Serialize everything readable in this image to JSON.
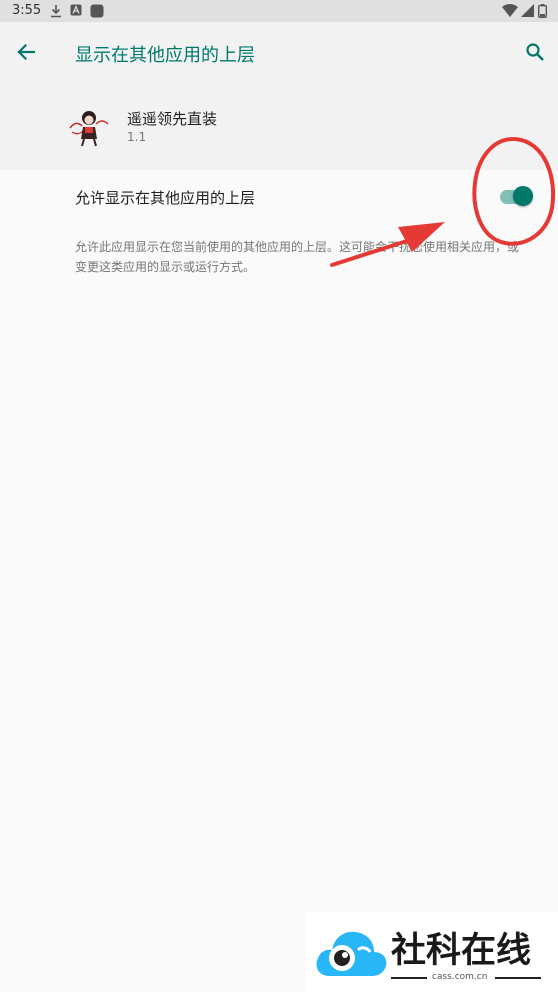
{
  "status_bar": {
    "time": "3:55",
    "icons": [
      "download-icon",
      "a-notification-icon",
      "app-notification-icon",
      "wifi-icon",
      "signal-icon",
      "battery-icon"
    ]
  },
  "app_bar": {
    "title": "显示在其他应用的上层",
    "back_icon": "arrow-back-icon",
    "search_icon": "search-icon"
  },
  "app_info": {
    "name": "遥遥领先直装",
    "version": "1.1"
  },
  "permission": {
    "label": "允许显示在其他应用的上层",
    "enabled": true,
    "description": "允许此应用显示在您当前使用的其他应用的上层。这可能会干扰您使用相关应用，或变更这类应用的显示或运行方式。"
  },
  "watermark": {
    "text": "社科在线",
    "url": "cass.com.cn"
  },
  "colors": {
    "accent": "#00796b",
    "annotation": "#e53935"
  }
}
